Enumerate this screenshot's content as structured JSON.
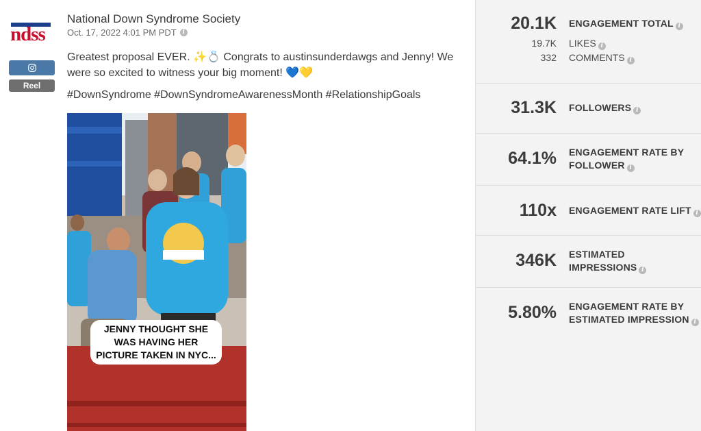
{
  "account": {
    "name": "National Down Syndrome Society",
    "date": "Oct. 17, 2022 4:01 PM PDT",
    "logo_text": "ndss",
    "network_icon": "instagram-icon",
    "post_type": "Reel"
  },
  "post": {
    "caption": "Greatest proposal EVER. ✨💍 Congrats to austinsunderdawgs and Jenny! We were so excited to witness your big moment! 💙💛",
    "hashtags": "#DownSyndrome #DownSyndromeAwarenessMonth #RelationshipGoals",
    "media_overlay_text": "JENNY THOUGHT SHE WAS HAVING HER PICTURE TAKEN IN NYC..."
  },
  "metrics": {
    "engagement_total": {
      "value": "20.1K",
      "label": "ENGAGEMENT TOTAL"
    },
    "likes": {
      "value": "19.7K",
      "label": "LIKES"
    },
    "comments": {
      "value": "332",
      "label": "COMMENTS"
    },
    "followers": {
      "value": "31.3K",
      "label": "FOLLOWERS"
    },
    "engagement_rate_follower": {
      "value": "64.1%",
      "label_line1": "ENGAGEMENT RATE BY",
      "label_line2": "FOLLOWER"
    },
    "engagement_rate_lift": {
      "value": "110x",
      "label": "ENGAGEMENT RATE LIFT"
    },
    "estimated_impressions": {
      "value": "346K",
      "label_line1": "ESTIMATED",
      "label_line2": "IMPRESSIONS"
    },
    "engagement_rate_impression": {
      "value": "5.80%",
      "label_line1": "ENGAGEMENT RATE BY",
      "label_line2": "ESTIMATED IMPRESSION"
    }
  },
  "colors": {
    "brand_red": "#c8102e",
    "brand_blue": "#1d3e8a",
    "network_button": "#4a79a8",
    "panel_bg": "#f3f3f3"
  }
}
